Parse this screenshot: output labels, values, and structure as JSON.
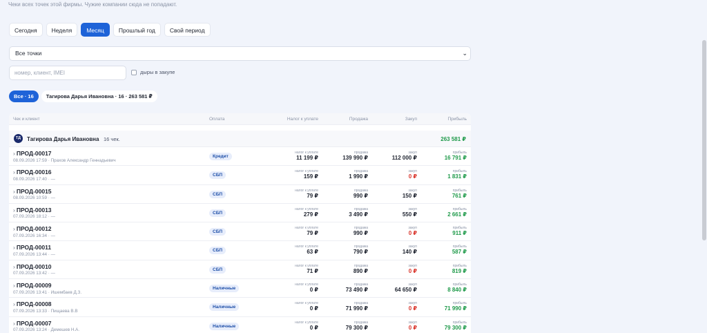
{
  "subtitle": "Чеки всех точек этой фирмы. Чужие компании сюда не попадают.",
  "periods": [
    "Сегодня",
    "Неделя",
    "Месяц",
    "Прошлый год",
    "Свой период"
  ],
  "active_period": "Месяц",
  "points_select": "Все точки",
  "search_placeholder": "номер, клиент, IMEI",
  "holes_checkbox": "дыры в закупе",
  "chips": {
    "all": "Все · 16",
    "seller": "Тагирова Дарья Ивановна · 16 · 263 581 ₽"
  },
  "headers": {
    "check": "Чек и клиент",
    "payment": "Оплата",
    "tax": "Налог к уплате",
    "sale": "Продажа",
    "cost": "Закуп",
    "profit": "Прибыль"
  },
  "group": {
    "initials": "ТД",
    "name": "Тагирова Дарья Ивановна",
    "count": "16 чек.",
    "total": "263 581 ₽"
  },
  "cell_labels": {
    "tax": "налог к уплате",
    "sale": "продажа",
    "cost": "закуп",
    "profit": "прибыль"
  },
  "rows": [
    {
      "id": "ПРОД-00017",
      "meta": "08.09.2026 17:59 · Прахов Александр Геннадьевич",
      "pay": "Кредит",
      "tax": "11 199 ₽",
      "sale": "139 990 ₽",
      "cost": "112 000 ₽",
      "cost_zero": false,
      "profit": "16 791 ₽"
    },
    {
      "id": "ПРОД-00016",
      "meta": "08.09.2026 17:40 · —",
      "pay": "СБП",
      "tax": "159 ₽",
      "sale": "1 990 ₽",
      "cost": "0 ₽",
      "cost_zero": true,
      "profit": "1 831 ₽"
    },
    {
      "id": "ПРОД-00015",
      "meta": "08.09.2026 10:59 · —",
      "pay": "СБП",
      "tax": "79 ₽",
      "sale": "990 ₽",
      "cost": "150 ₽",
      "cost_zero": false,
      "profit": "761 ₽"
    },
    {
      "id": "ПРОД-00013",
      "meta": "07.09.2026 18:12 · —",
      "pay": "СБП",
      "tax": "279 ₽",
      "sale": "3 490 ₽",
      "cost": "550 ₽",
      "cost_zero": false,
      "profit": "2 661 ₽"
    },
    {
      "id": "ПРОД-00012",
      "meta": "07.09.2026 16:34 · —",
      "pay": "СБП",
      "tax": "79 ₽",
      "sale": "990 ₽",
      "cost": "0 ₽",
      "cost_zero": true,
      "profit": "911 ₽"
    },
    {
      "id": "ПРОД-00011",
      "meta": "07.09.2026 13:44 · —",
      "pay": "СБП",
      "tax": "63 ₽",
      "sale": "790 ₽",
      "cost": "140 ₽",
      "cost_zero": false,
      "profit": "587 ₽"
    },
    {
      "id": "ПРОД-00010",
      "meta": "07.09.2026 13:42 · —",
      "pay": "СБП",
      "tax": "71 ₽",
      "sale": "890 ₽",
      "cost": "0 ₽",
      "cost_zero": true,
      "profit": "819 ₽"
    },
    {
      "id": "ПРОД-00009",
      "meta": "07.09.2026 13:41 · Ишембаев Д.З.",
      "pay": "Наличные",
      "tax": "0 ₽",
      "sale": "73 490 ₽",
      "cost": "64 650 ₽",
      "cost_zero": false,
      "profit": "8 840 ₽"
    },
    {
      "id": "ПРОД-00008",
      "meta": "07.09.2026 13:33 · Пищаева В.В",
      "pay": "Наличные",
      "tax": "0 ₽",
      "sale": "71 990 ₽",
      "cost": "0 ₽",
      "cost_zero": true,
      "profit": "71 990 ₽"
    },
    {
      "id": "ПРОД-00007",
      "meta": "07.09.2026 13:24 · Демешев Н.А.",
      "pay": "Наличные",
      "tax": "0 ₽",
      "sale": "79 300 ₽",
      "cost": "0 ₽",
      "cost_zero": true,
      "profit": "79 300 ₽"
    }
  ]
}
